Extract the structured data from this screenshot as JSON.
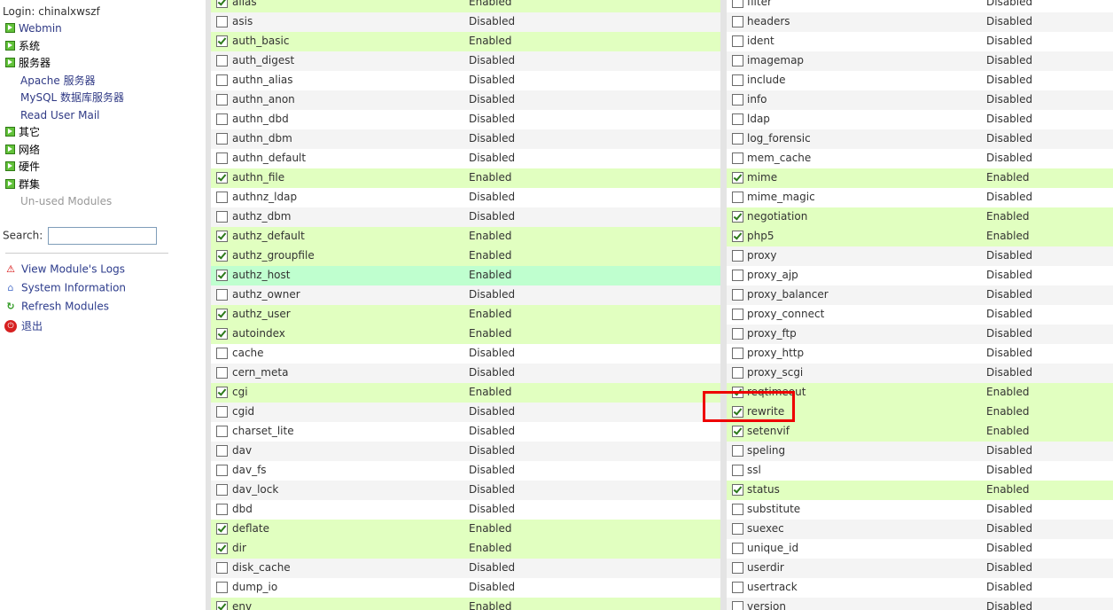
{
  "sidebar": {
    "login": "Login: chinalxwszf",
    "menu": [
      {
        "label": "Webmin",
        "kind": "cat-link"
      },
      {
        "label": "系统",
        "kind": "cat"
      },
      {
        "label": "服务器",
        "kind": "cat"
      },
      {
        "label": "Apache 服务器",
        "kind": "sub"
      },
      {
        "label": "MySQL 数据库服务器",
        "kind": "sub"
      },
      {
        "label": "Read User Mail",
        "kind": "sub"
      },
      {
        "label": "其它",
        "kind": "cat"
      },
      {
        "label": "网络",
        "kind": "cat"
      },
      {
        "label": "硬件",
        "kind": "cat"
      },
      {
        "label": "群集",
        "kind": "cat"
      },
      {
        "label": "Un-used Modules",
        "kind": "grey"
      }
    ],
    "search_label": "Search:",
    "search_value": "",
    "actions": [
      {
        "label": "View Module's Logs",
        "icon": "warning-icon"
      },
      {
        "label": "System Information",
        "icon": "home-icon"
      },
      {
        "label": "Refresh Modules",
        "icon": "refresh-icon"
      },
      {
        "label": "退出",
        "icon": "power-icon"
      }
    ]
  },
  "status_labels": {
    "on": "Enabled",
    "off": "Disabled"
  },
  "modules_left": [
    {
      "name": "alias",
      "enabled": true
    },
    {
      "name": "asis",
      "enabled": false
    },
    {
      "name": "auth_basic",
      "enabled": true
    },
    {
      "name": "auth_digest",
      "enabled": false
    },
    {
      "name": "authn_alias",
      "enabled": false
    },
    {
      "name": "authn_anon",
      "enabled": false
    },
    {
      "name": "authn_dbd",
      "enabled": false
    },
    {
      "name": "authn_dbm",
      "enabled": false
    },
    {
      "name": "authn_default",
      "enabled": false
    },
    {
      "name": "authn_file",
      "enabled": true
    },
    {
      "name": "authnz_ldap",
      "enabled": false
    },
    {
      "name": "authz_dbm",
      "enabled": false
    },
    {
      "name": "authz_default",
      "enabled": true
    },
    {
      "name": "authz_groupfile",
      "enabled": true
    },
    {
      "name": "authz_host",
      "enabled": true,
      "highlight": true
    },
    {
      "name": "authz_owner",
      "enabled": false
    },
    {
      "name": "authz_user",
      "enabled": true
    },
    {
      "name": "autoindex",
      "enabled": true
    },
    {
      "name": "cache",
      "enabled": false
    },
    {
      "name": "cern_meta",
      "enabled": false
    },
    {
      "name": "cgi",
      "enabled": true
    },
    {
      "name": "cgid",
      "enabled": false
    },
    {
      "name": "charset_lite",
      "enabled": false
    },
    {
      "name": "dav",
      "enabled": false
    },
    {
      "name": "dav_fs",
      "enabled": false
    },
    {
      "name": "dav_lock",
      "enabled": false
    },
    {
      "name": "dbd",
      "enabled": false
    },
    {
      "name": "deflate",
      "enabled": true
    },
    {
      "name": "dir",
      "enabled": true
    },
    {
      "name": "disk_cache",
      "enabled": false
    },
    {
      "name": "dump_io",
      "enabled": false
    },
    {
      "name": "env",
      "enabled": true
    }
  ],
  "modules_right": [
    {
      "name": "filter",
      "enabled": false
    },
    {
      "name": "headers",
      "enabled": false
    },
    {
      "name": "ident",
      "enabled": false
    },
    {
      "name": "imagemap",
      "enabled": false
    },
    {
      "name": "include",
      "enabled": false
    },
    {
      "name": "info",
      "enabled": false
    },
    {
      "name": "ldap",
      "enabled": false
    },
    {
      "name": "log_forensic",
      "enabled": false
    },
    {
      "name": "mem_cache",
      "enabled": false
    },
    {
      "name": "mime",
      "enabled": true
    },
    {
      "name": "mime_magic",
      "enabled": false
    },
    {
      "name": "negotiation",
      "enabled": true
    },
    {
      "name": "php5",
      "enabled": true
    },
    {
      "name": "proxy",
      "enabled": false
    },
    {
      "name": "proxy_ajp",
      "enabled": false
    },
    {
      "name": "proxy_balancer",
      "enabled": false
    },
    {
      "name": "proxy_connect",
      "enabled": false
    },
    {
      "name": "proxy_ftp",
      "enabled": false
    },
    {
      "name": "proxy_http",
      "enabled": false
    },
    {
      "name": "proxy_scgi",
      "enabled": false
    },
    {
      "name": "reqtimeout",
      "enabled": true
    },
    {
      "name": "rewrite",
      "enabled": true,
      "marked": true
    },
    {
      "name": "setenvif",
      "enabled": true
    },
    {
      "name": "speling",
      "enabled": false
    },
    {
      "name": "ssl",
      "enabled": false
    },
    {
      "name": "status",
      "enabled": true
    },
    {
      "name": "substitute",
      "enabled": false
    },
    {
      "name": "suexec",
      "enabled": false
    },
    {
      "name": "unique_id",
      "enabled": false
    },
    {
      "name": "userdir",
      "enabled": false
    },
    {
      "name": "usertrack",
      "enabled": false
    },
    {
      "name": "version",
      "enabled": false
    }
  ]
}
